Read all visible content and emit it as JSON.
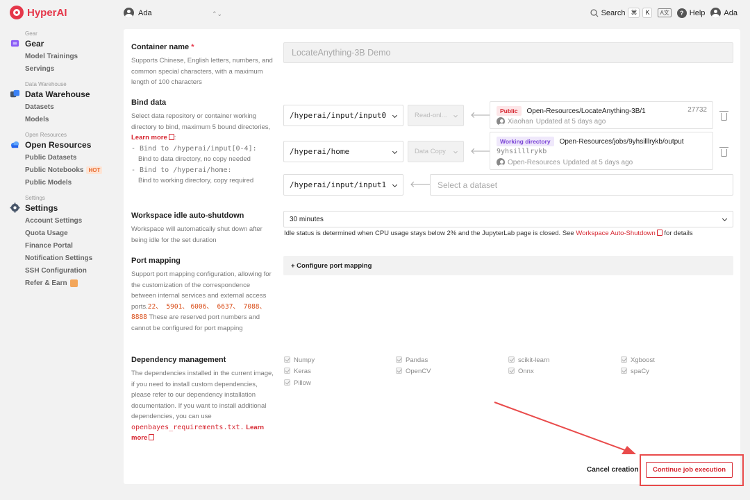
{
  "brand": {
    "name": "HyperAI"
  },
  "topbar": {
    "workspace": "Ada",
    "search_label": "Search",
    "shortcut_cmd": "⌘",
    "shortcut_key": "K",
    "lang_icon_text": "A文",
    "help_label": "Help",
    "user": "Ada"
  },
  "sidebar": {
    "groups": [
      {
        "caption": "Gear",
        "title": "Gear",
        "icon": "gear-cube-icon",
        "items": [
          "Model Trainings",
          "Servings"
        ]
      },
      {
        "caption": "Data Warehouse",
        "title": "Data Warehouse",
        "icon": "database-icon",
        "items": [
          "Datasets",
          "Models"
        ]
      },
      {
        "caption": "Open Resources",
        "title": "Open Resources",
        "icon": "cloud-icon",
        "items": [
          "Public Datasets",
          "Public Notebooks",
          "Public Models"
        ],
        "badge": "HOT"
      },
      {
        "caption": "Settings",
        "title": "Settings",
        "icon": "settings-gear-icon",
        "items": [
          "Account Settings",
          "Quota Usage",
          "Finance Portal",
          "Notification Settings",
          "SSH Configuration",
          "Refer & Earn"
        ]
      }
    ]
  },
  "form": {
    "container_name": {
      "label": "Container name",
      "required_mark": "*",
      "help": "Supports Chinese, English letters, numbers, and common special characters, with a maximum length of 100 characters",
      "value": "LocateAnything-3B Demo"
    },
    "bind_data": {
      "label": "Bind data",
      "help": "Select data repository or container working directory to bind, maximum 5 bound directories,",
      "learn_more": "Learn more",
      "colon": ":",
      "rule1_code": "- Bind to /hyperai/input[0-4]:",
      "rule1_text": "Bind to data directory, no copy needed",
      "rule2_code": "- Bind to /hyperai/home:",
      "rule2_text": "Bind to working directory, copy required",
      "rows": [
        {
          "path": "/hyperai/input/input0",
          "mode": "Read-onl...",
          "tag": "Public",
          "resource": "Open-Resources/LocateAnything-3B/1",
          "count": "27732",
          "owner": "Xiaohan",
          "updated": "Updated at 5 days ago"
        },
        {
          "path": "/hyperai/home",
          "mode": "Data Copy",
          "tag": "Working directory",
          "resource": "Open-Resources/jobs/9yhsilllrykb/output",
          "job_id": "9yhsilllrykb",
          "owner": "Open-Resources",
          "updated": "Updated at 5 days ago"
        },
        {
          "path": "/hyperai/input/input1",
          "placeholder": "Select a dataset"
        }
      ]
    },
    "idle": {
      "label": "Workspace idle auto-shutdown",
      "help": "Workspace will automatically shut down after being idle for the set duration",
      "value": "30 minutes",
      "note": "Idle status is determined when CPU usage stays below 2% and the JupyterLab page is closed. See",
      "note_link": "Workspace Auto-Shutdown",
      "note_tail": "for details"
    },
    "port": {
      "label": "Port mapping",
      "help": "Support port mapping configuration, allowing for the customization of the correspondence between internal services and external access ports.",
      "ports_line1": "22、 5901、",
      "ports_line2": "6006、 6637、 7088、 8888",
      "help_tail": " These are reserved port numbers and cannot be configured for port mapping",
      "button": "+ Configure port mapping"
    },
    "deps": {
      "label": "Dependency management",
      "help": "The dependencies installed in the current image, if you need to install custom dependencies, please refer to our dependency installation documentation. If you want to install additional dependencies, you can use",
      "req_file": "openbayes_requirements.txt.",
      "learn_more": "Learn more",
      "items": [
        "Numpy",
        "Pandas",
        "scikit-learn",
        "Xgboost",
        "Keras",
        "OpenCV",
        "Onnx",
        "spaCy",
        "Pillow"
      ]
    },
    "actions": {
      "cancel": "Cancel creation",
      "continue": "Continue job execution"
    }
  },
  "colors": {
    "brand": "#e5374a",
    "annotation": "#e94b4b"
  }
}
